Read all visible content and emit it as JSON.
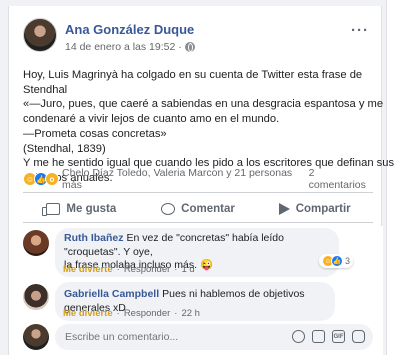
{
  "post": {
    "author": "Ana González Duque",
    "timestamp": "14 de enero a las 19:52",
    "separator": "·",
    "text_lines": [
      "Hoy, Luis Magrinyà ha colgado en su cuenta de Twitter esta frase de",
      "Stendhal",
      "«—Juro, pues, que caeré a sabiendas en una desgracia espantosa y me",
      "condenaré a vivir lejos de cuanto amo en el mundo.",
      "—Prometa cosas concretas»",
      "(Stendhal, 1839)",
      "Y me he sentido igual que cuando les pido a los escritores que definan sus",
      "objetivos anuales."
    ],
    "reactions_text": "Chelo Díaz Toledo, Valeria Marcon y 21 personas más",
    "comment_count": "2 comentarios"
  },
  "actions": {
    "like": "Me gusta",
    "comment": "Comentar",
    "share": "Compartir"
  },
  "comments": [
    {
      "author": "Ruth Ibañez",
      "text_lines": [
        "En vez de \"concretas\" había leído \"croquetas\". Y oye,",
        "la frase molaba incluso más. 😜"
      ],
      "reaction_label": "Me divierte",
      "reply": "Responder",
      "time": "1 d",
      "reaction_count": "3"
    },
    {
      "author": "Gabriella Campbell",
      "text": "Pues ni hablemos de objetivos generales xD",
      "reaction_label": "Me divierte",
      "reply": "Responder",
      "time": "22 h"
    }
  ],
  "composer": {
    "placeholder": "Escribe un comentario..."
  },
  "icons": {
    "more": "more-options-icon",
    "privacy": "globe-icon",
    "haha": "haha-reaction-icon",
    "like": "like-reaction-icon",
    "wow": "wow-reaction-icon"
  },
  "colors": {
    "link": "#385898",
    "secondary": "#65676b",
    "bubble": "#f0f2f5",
    "like_blue": "#1877f2",
    "haha_yellow": "#f7b125"
  }
}
